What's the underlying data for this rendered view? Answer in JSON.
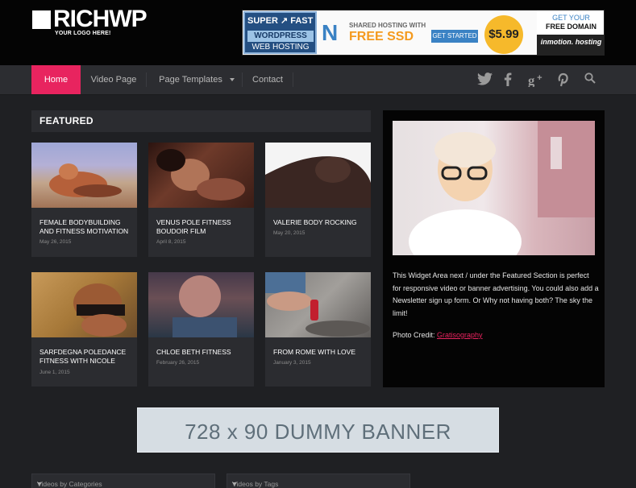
{
  "logo": {
    "text": "RICHWP",
    "tagline": "YOUR LOGO HERE!"
  },
  "ad_top": {
    "left_line1": "SUPER ↗ FAST",
    "left_line2": "WORDPRESS",
    "left_line3": "WEB HOSTING",
    "shared": "SHARED HOSTING WITH",
    "free_ssd": "FREE SSD",
    "get_started": "GET STARTED",
    "price": "$5.99",
    "get_your": "GET YOUR",
    "free_domain": "FREE DOMAIN",
    "brand": "inmotion. hosting"
  },
  "nav": {
    "items": [
      "Home",
      "Video Page",
      "Page Templates",
      "Contact"
    ],
    "active_index": 0
  },
  "social": [
    "twitter-icon",
    "facebook-icon",
    "google-plus-icon",
    "pinterest-icon",
    "search-icon"
  ],
  "featured": {
    "heading": "FEATURED",
    "cards": [
      {
        "title": "FEMALE BODYBUILDING AND FITNESS MOTIVATION",
        "date": "May 26, 2015"
      },
      {
        "title": "VENUS POLE FITNESS BOUDOIR FILM",
        "date": "April 8, 2015"
      },
      {
        "title": "VALERIE BODY ROCKING",
        "date": "May 20, 2015"
      },
      {
        "title": "SARFDEGNA POLEDANCE FITNESS WITH NICOLE",
        "date": "June 1, 2015"
      },
      {
        "title": "CHLOE BETH FITNESS",
        "date": "February 26, 2015"
      },
      {
        "title": "FROM ROME WITH LOVE",
        "date": "January 3, 2015"
      }
    ]
  },
  "widget": {
    "text": "This Widget Area next / under the Featured Section is perfect for responsive video or banner advertising. You could also add a Newsletter sign up form. Or Why not having both? The sky the limit!",
    "credit_label": "Photo Credit: ",
    "credit_link": "Gratisography"
  },
  "banner": {
    "text": "728 x 90 DUMMY BANNER"
  },
  "selects": [
    {
      "value": "Videos by Categories"
    },
    {
      "value": "Videos by Tags"
    }
  ],
  "colors": {
    "accent": "#e8245f",
    "background": "#1f2023",
    "panel": "#2b2c30"
  }
}
